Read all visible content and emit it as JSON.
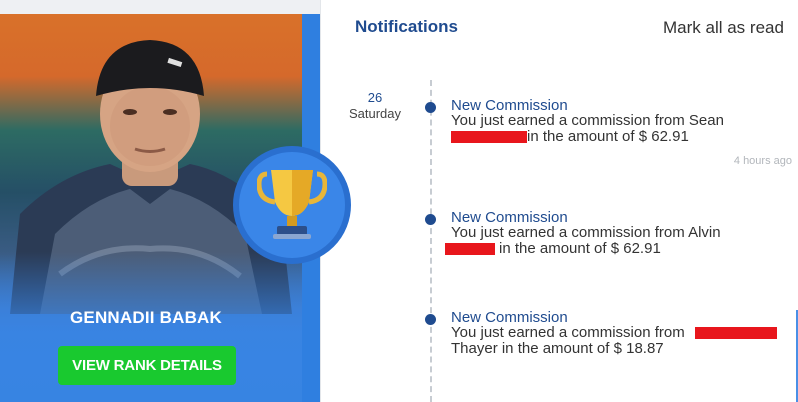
{
  "profile": {
    "name": "GENNADII BABAK",
    "rank_button_label": "VIEW RANK DETAILS"
  },
  "colors": {
    "accent_blue": "#1f4b8f",
    "button_green": "#19c92f",
    "redaction": "#e8161c"
  },
  "notifications": {
    "title": "Notifications",
    "mark_all_label": "Mark all as read",
    "date_day": "26",
    "date_weekday": "Saturday",
    "items": [
      {
        "title": "New Commission",
        "line1": "You just earned a commission from Sean",
        "line2": "in the amount of $ 62.91",
        "time": "4 hours ago"
      },
      {
        "title": "New Commission",
        "line1": "You just earned a commission from Alvin",
        "line2": "in the amount of $ 62.91"
      },
      {
        "title": "New Commission",
        "line1": "You just earned a commission from",
        "line2": "Thayer in the amount of $ 18.87"
      }
    ]
  }
}
